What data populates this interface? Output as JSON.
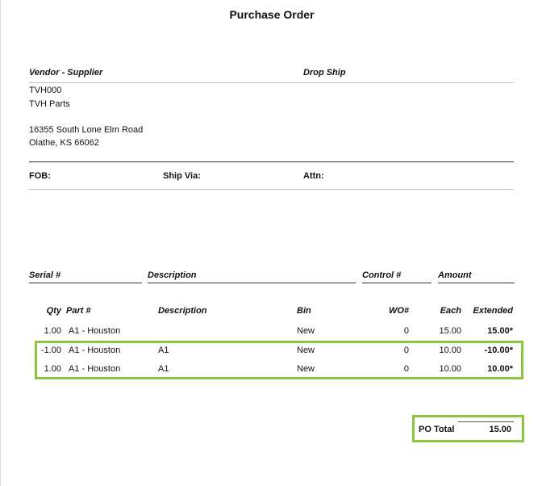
{
  "title": "Purchase Order",
  "vendor": {
    "header": "Vendor - Supplier",
    "code": "TVH000",
    "name": "TVH Parts",
    "address1": "16355 South Lone Elm Road",
    "address2": "Olathe, KS 66062"
  },
  "drop_ship": {
    "header": "Drop Ship"
  },
  "shipping": {
    "fob_label": "FOB:",
    "ship_via_label": "Ship Via:",
    "attn_label": "Attn:"
  },
  "serial_headers": {
    "serial": "Serial #",
    "description": "Description",
    "control": "Control #",
    "amount": "Amount"
  },
  "line_headers": {
    "qty": "Qty",
    "part": "Part #",
    "description": "Description",
    "bin": "Bin",
    "wo": "WO#",
    "each": "Each",
    "extended": "Extended"
  },
  "lines": [
    {
      "qty": "1.00",
      "part": "A1 - Houston",
      "description": "",
      "bin": "New",
      "wo": "0",
      "each": "15.00",
      "extended": "15.00*"
    },
    {
      "qty": "-1.00",
      "part": "A1 - Houston",
      "description": "A1",
      "bin": "New",
      "wo": "0",
      "each": "10.00",
      "extended": "-10.00*"
    },
    {
      "qty": "1.00",
      "part": "A1 - Houston",
      "description": "A1",
      "bin": "New",
      "wo": "0",
      "each": "10.00",
      "extended": "10.00*"
    }
  ],
  "total": {
    "label": "PO Total",
    "value": "15.00"
  },
  "colors": {
    "highlight": "#8cc63f"
  }
}
